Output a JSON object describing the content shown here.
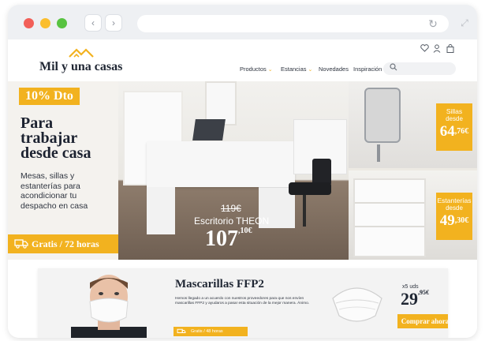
{
  "brand": {
    "name": "Mil y una casas",
    "accent": "#f2b21f"
  },
  "header": {
    "nav": [
      {
        "label": "Productos",
        "has_caret": true
      },
      {
        "label": "Estancias",
        "has_caret": true
      },
      {
        "label": "Novedades",
        "has_caret": false
      },
      {
        "label": "Inspiración",
        "has_caret": false
      }
    ],
    "caret": "⌄",
    "icons": [
      "heart-icon",
      "user-icon",
      "bag-icon",
      "search-icon"
    ]
  },
  "hero": {
    "badge": "10% Dto",
    "headline_1": "Para",
    "headline_2": "trabajar",
    "headline_3": "desde casa",
    "subcopy": "Mesas, sillas y estanterías para acondicionar tu despacho en casa",
    "shipping": "Gratis / 72 horas",
    "product": {
      "old_price": "119€",
      "name": "Escritorio THEON",
      "price_int": "107",
      "price_dec": ",10€"
    }
  },
  "tiles": [
    {
      "category": "Sillas",
      "desde": "desde",
      "price_int": "64",
      "price_dec": ",76€"
    },
    {
      "category": "Estanterías",
      "desde": "desde",
      "price_int": "49",
      "price_dec": ",30€"
    }
  ],
  "promo": {
    "title": "Mascarillas FFP2",
    "description": "Hemos llegado a un acuerdo con nuestros proveedores para que nos envíen mascarillas FFP2 y ayudaros a pasar esta situación de la mejor manera. Ánimo.",
    "shipping": "Gratis / 48 horas",
    "units": "x5 uds",
    "price_int": "29",
    "price_dec": ",95€",
    "cta": "Comprar ahora"
  }
}
